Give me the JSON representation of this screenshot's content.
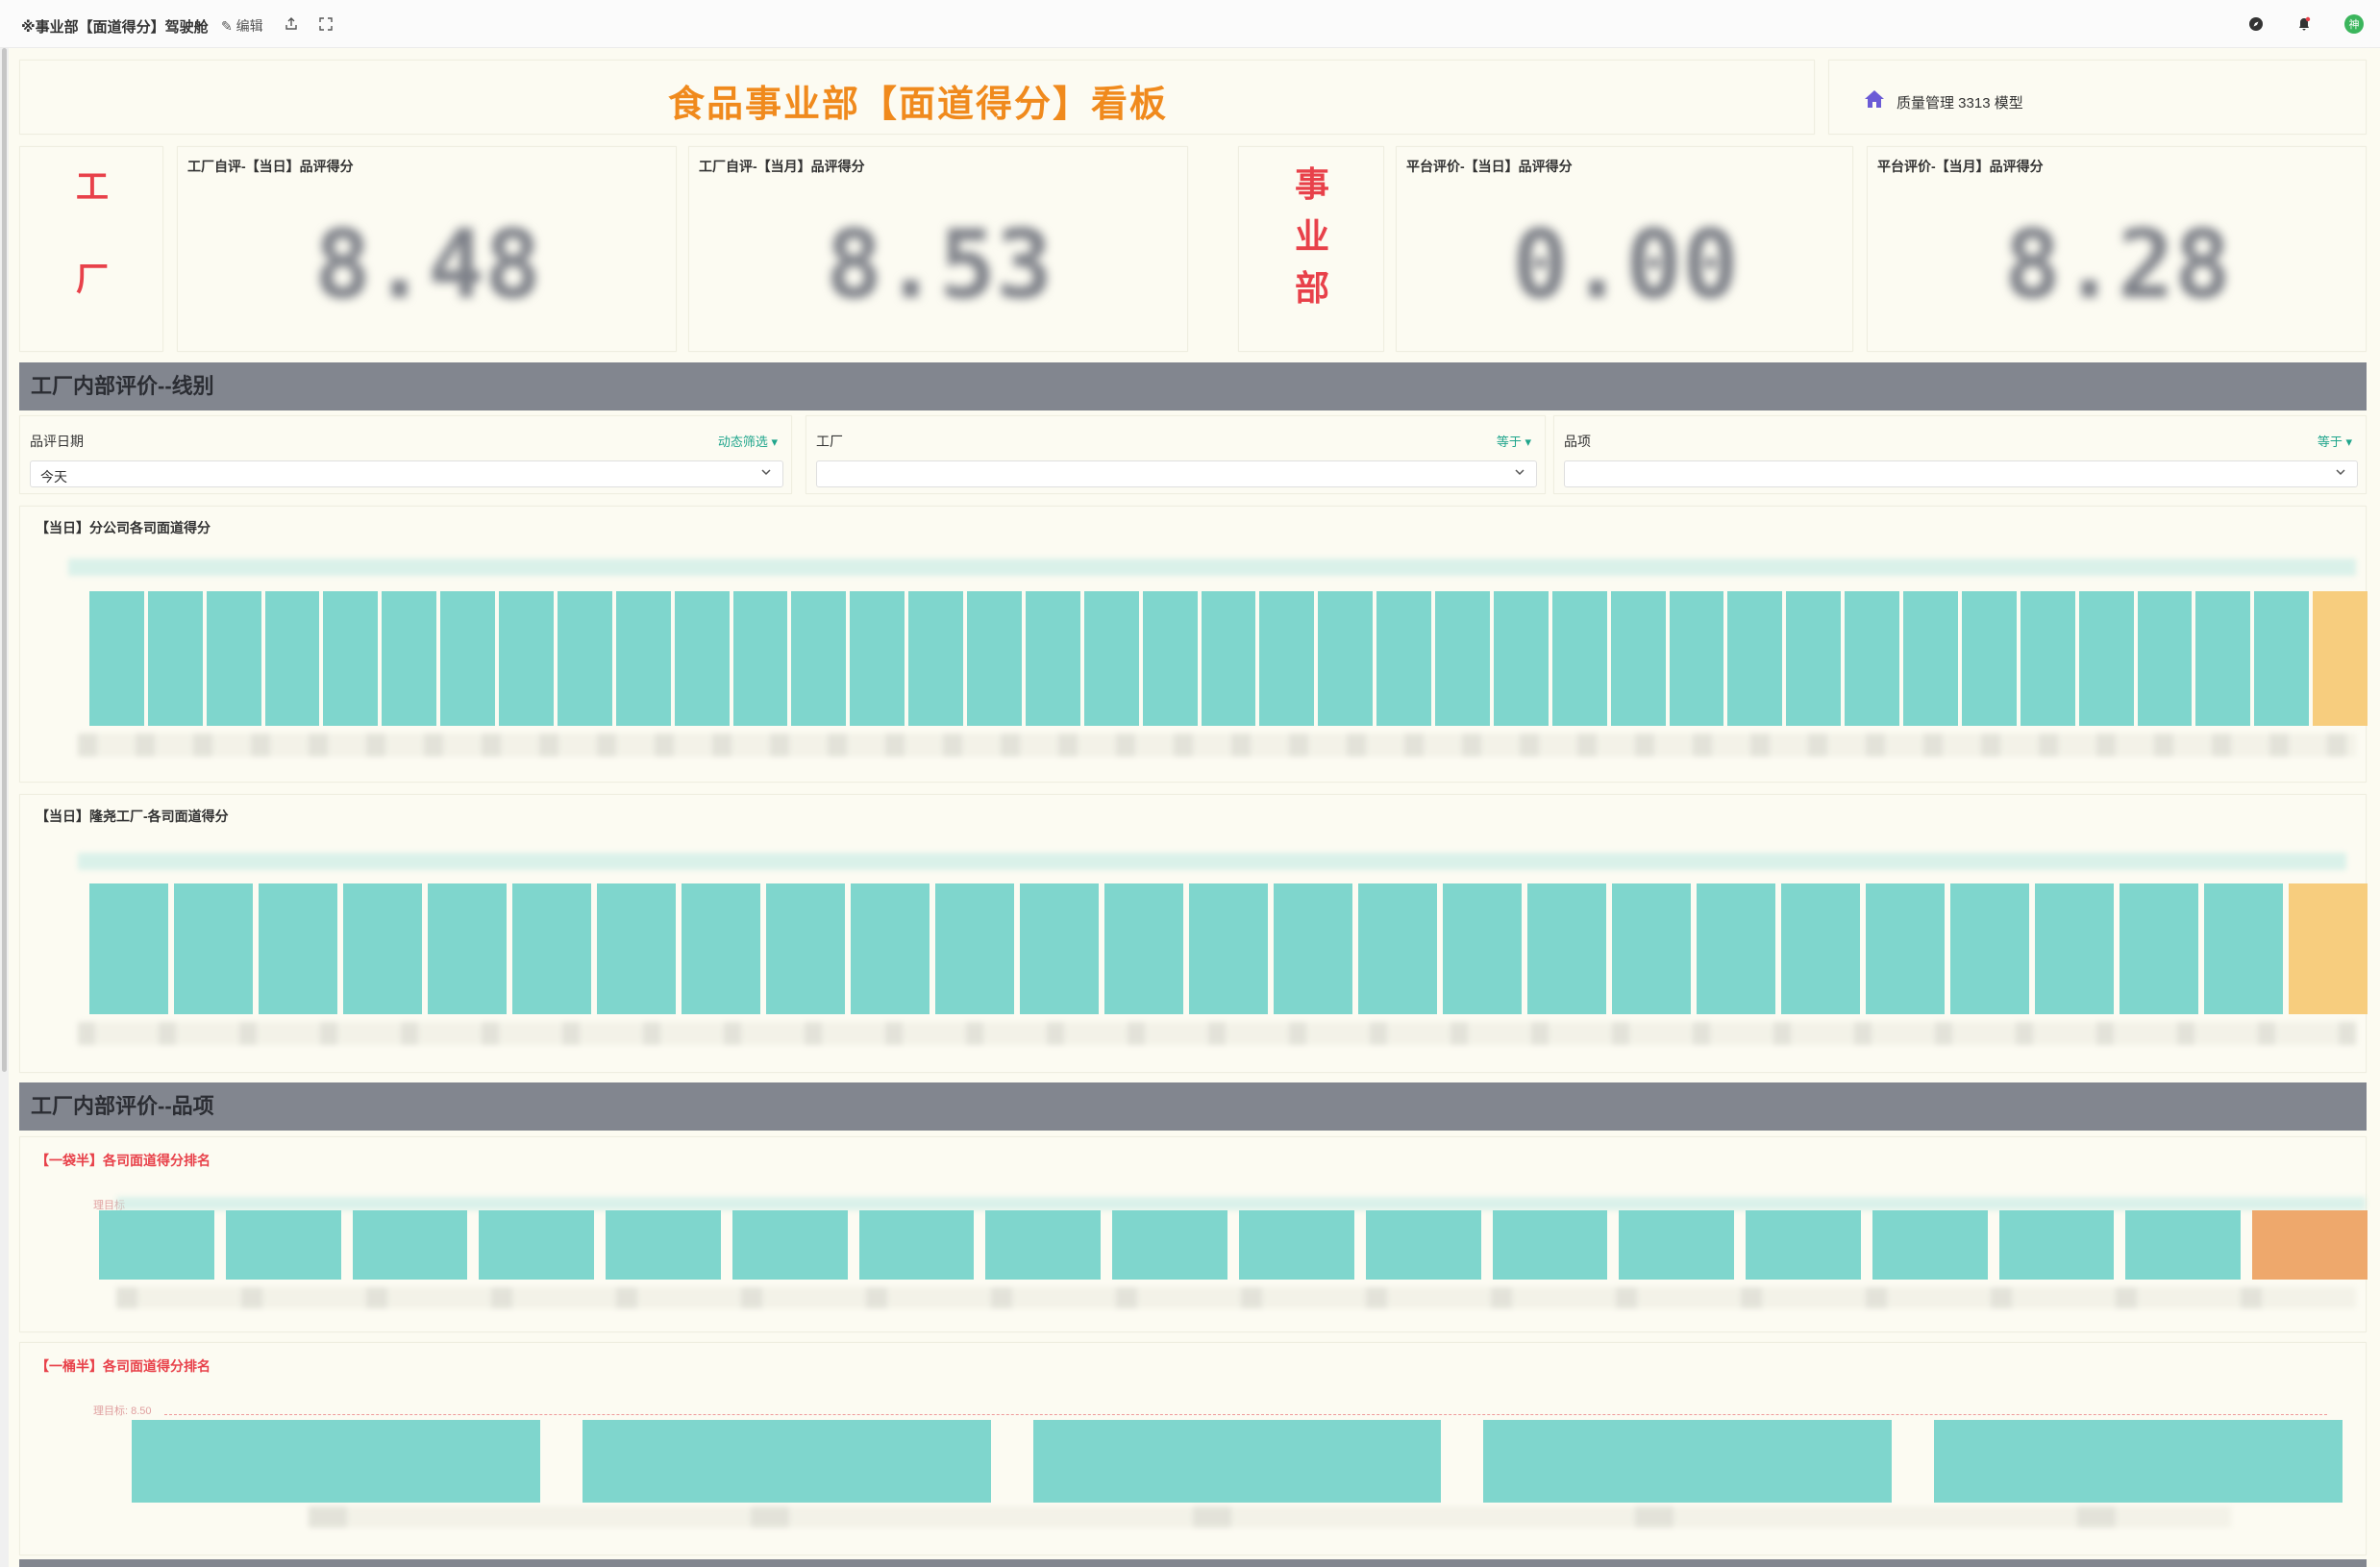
{
  "topbar": {
    "title": "※事业部【面道得分】驾驶舱",
    "edit_label": "编辑",
    "user_initial": "神"
  },
  "header": {
    "title": "食品事业部【面道得分】看板",
    "model_label": "质量管理 3313 模型"
  },
  "factory_tag": [
    "工",
    "厂"
  ],
  "division_tag": [
    "事",
    "业",
    "部"
  ],
  "kpis": [
    {
      "label": "工厂自评-【当日】品评得分",
      "value": "8.48"
    },
    {
      "label": "工厂自评-【当月】品评得分",
      "value": "8.53"
    },
    {
      "label": "平台评价-【当日】品评得分",
      "value": "0.00"
    },
    {
      "label": "平台评价-【当月】品评得分",
      "value": "8.28"
    }
  ],
  "section1": {
    "title": "工厂内部评价--线别"
  },
  "filters": [
    {
      "label": "品评日期",
      "op": "动态筛选",
      "value": "今天"
    },
    {
      "label": "工厂",
      "op": "等于",
      "value": ""
    },
    {
      "label": "品项",
      "op": "等于",
      "value": ""
    }
  ],
  "charts": {
    "c1": {
      "title": "【当日】分公司各司面道得分"
    },
    "c2": {
      "title": "【当日】隆尧工厂-各司面道得分"
    },
    "c3": {
      "title": "【一袋半】各司面道得分排名",
      "target_label": "理目标"
    },
    "c4": {
      "title": "【一桶半】各司面道得分排名",
      "target_label": "理目标: 8.50"
    }
  },
  "section2": {
    "title": "工厂内部评价--品项"
  },
  "colors": {
    "accent": "#f08a1d",
    "bar": "#7fd6cd",
    "highlight": "#f7cd7e",
    "orange": "#eea86c",
    "section": "#82868f",
    "tag_red": "#e8414a",
    "teal": "#1fa58c"
  }
}
